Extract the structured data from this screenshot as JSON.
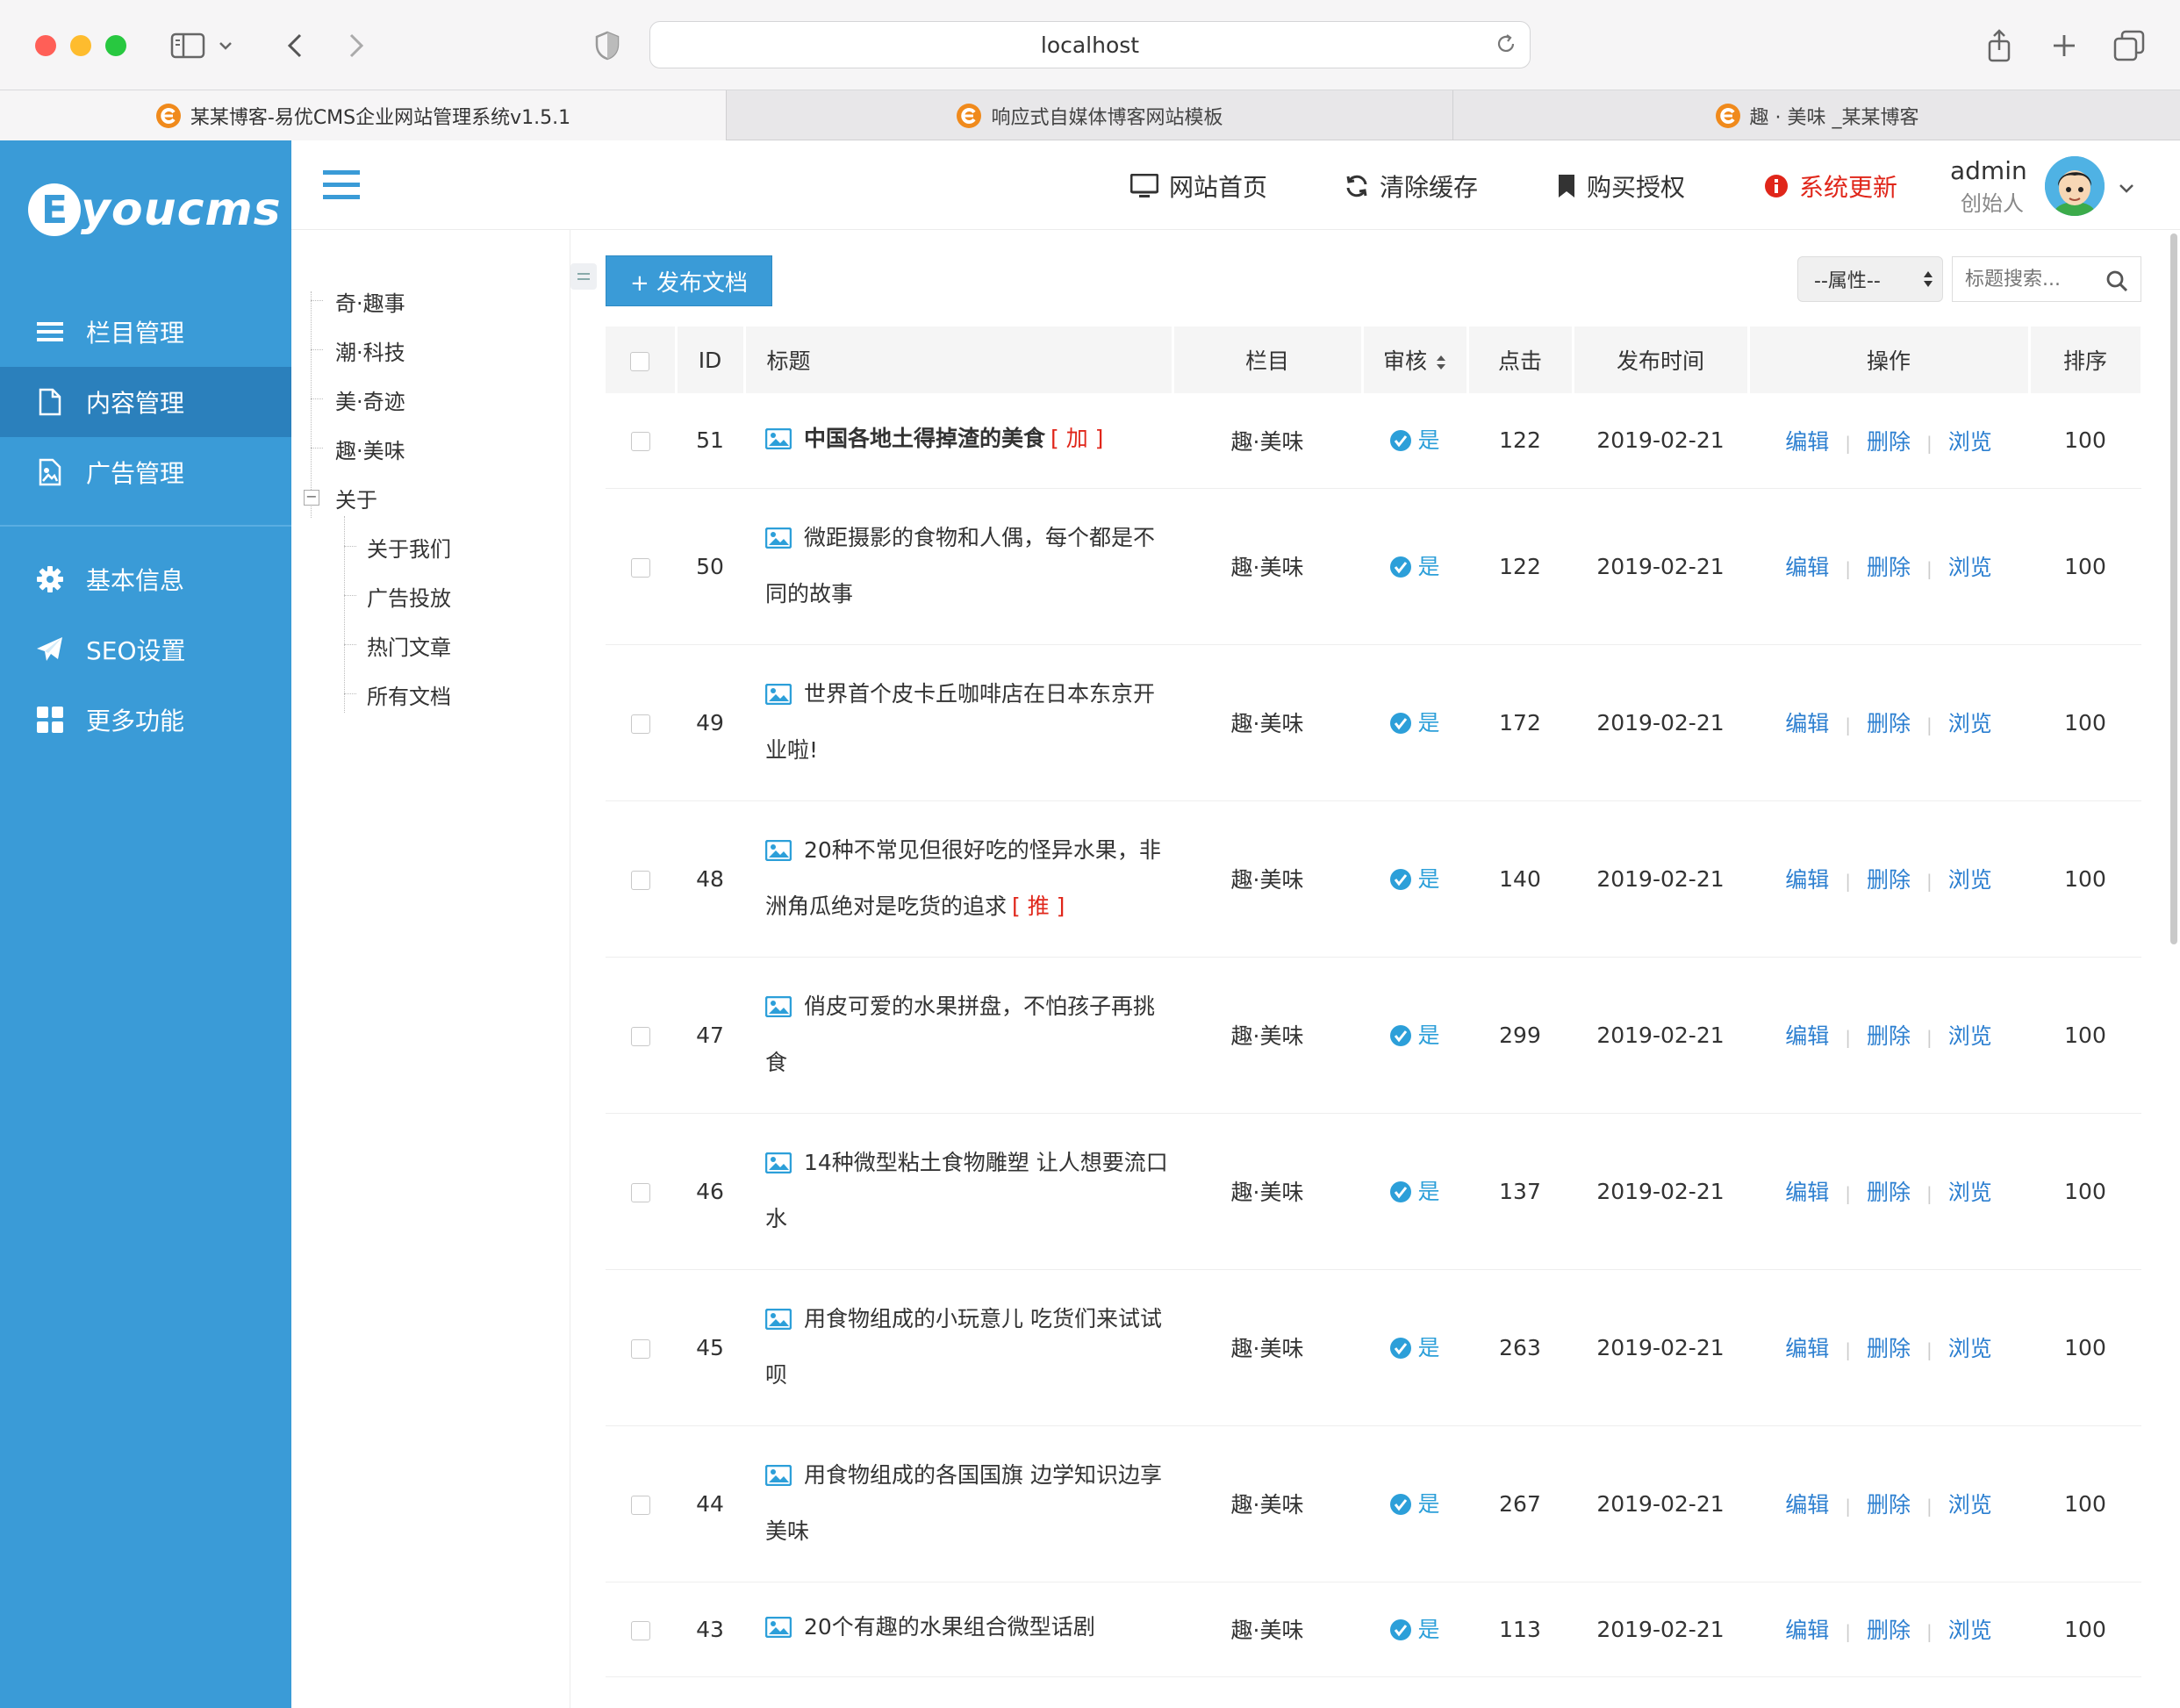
{
  "browser": {
    "address": "localhost",
    "tabs": [
      {
        "label": "某某博客-易优CMS企业网站管理系统v1.5.1",
        "active": true
      },
      {
        "label": "响应式自媒体博客网站模板",
        "active": false
      },
      {
        "label": "趣 · 美味 _某某博客",
        "active": false
      }
    ]
  },
  "sidebar": {
    "logo_text": "youcms",
    "logo_letter": "E",
    "items": [
      {
        "label": "栏目管理",
        "icon": "list-icon",
        "active": false
      },
      {
        "label": "内容管理",
        "icon": "document-icon",
        "active": true
      },
      {
        "label": "广告管理",
        "icon": "image-file-icon",
        "active": false
      },
      {
        "label": "基本信息",
        "icon": "gear-icon",
        "active": false
      },
      {
        "label": "SEO设置",
        "icon": "paper-plane-icon",
        "active": false
      },
      {
        "label": "更多功能",
        "icon": "grid-icon",
        "active": false
      }
    ]
  },
  "header": {
    "nav": [
      {
        "label": "网站首页",
        "icon": "monitor-icon"
      },
      {
        "label": "清除缓存",
        "icon": "refresh-icon"
      },
      {
        "label": "购买授权",
        "icon": "bookmark-icon"
      },
      {
        "label": "系统更新",
        "icon": "info-icon"
      }
    ],
    "admin_name": "admin",
    "admin_role": "创始人"
  },
  "tree": {
    "items": [
      "奇·趣事",
      "潮·科技",
      "美·奇迹",
      "趣·美味",
      "关于"
    ],
    "children": [
      "关于我们",
      "广告投放",
      "热门文章",
      "所有文档"
    ]
  },
  "toolbar": {
    "publish_label": "+ 发布文档",
    "attribute_select": "--属性--",
    "search_placeholder": "标题搜索..."
  },
  "table": {
    "columns": [
      "ID",
      "标题",
      "栏目",
      "审核",
      "点击",
      "发布时间",
      "操作",
      "排序"
    ],
    "actions": [
      "编辑",
      "删除",
      "浏览"
    ],
    "rows": [
      {
        "id": "51",
        "title": "中国各地土得掉渣的美食",
        "flag": "[ 加 ]",
        "bold": true,
        "column": "趣·美味",
        "audit": "是",
        "clicks": "122",
        "date": "2019-02-21",
        "sort": "100"
      },
      {
        "id": "50",
        "title": "微距摄影的食物和人偶，每个都是不同的故事",
        "flag": "",
        "bold": false,
        "column": "趣·美味",
        "audit": "是",
        "clicks": "122",
        "date": "2019-02-21",
        "sort": "100"
      },
      {
        "id": "49",
        "title": "世界首个皮卡丘咖啡店在日本东京开业啦!",
        "flag": "",
        "bold": false,
        "column": "趣·美味",
        "audit": "是",
        "clicks": "172",
        "date": "2019-02-21",
        "sort": "100"
      },
      {
        "id": "48",
        "title": "20种不常见但很好吃的怪异水果，非洲角瓜绝对是吃货的追求",
        "flag": "[ 推 ]",
        "bold": false,
        "column": "趣·美味",
        "audit": "是",
        "clicks": "140",
        "date": "2019-02-21",
        "sort": "100"
      },
      {
        "id": "47",
        "title": "俏皮可爱的水果拼盘，不怕孩子再挑食",
        "flag": "",
        "bold": false,
        "column": "趣·美味",
        "audit": "是",
        "clicks": "299",
        "date": "2019-02-21",
        "sort": "100"
      },
      {
        "id": "46",
        "title": "14种微型粘土食物雕塑 让人想要流口水",
        "flag": "",
        "bold": false,
        "column": "趣·美味",
        "audit": "是",
        "clicks": "137",
        "date": "2019-02-21",
        "sort": "100"
      },
      {
        "id": "45",
        "title": "用食物组成的小玩意儿 吃货们来试试呗",
        "flag": "",
        "bold": false,
        "column": "趣·美味",
        "audit": "是",
        "clicks": "263",
        "date": "2019-02-21",
        "sort": "100"
      },
      {
        "id": "44",
        "title": "用食物组成的各国国旗 边学知识边享美味",
        "flag": "",
        "bold": false,
        "column": "趣·美味",
        "audit": "是",
        "clicks": "267",
        "date": "2019-02-21",
        "sort": "100"
      },
      {
        "id": "43",
        "title": "20个有趣的水果组合微型话剧",
        "flag": "",
        "bold": false,
        "column": "趣·美味",
        "audit": "是",
        "clicks": "113",
        "date": "2019-02-21",
        "sort": "100"
      }
    ]
  },
  "colors": {
    "sidebar_bg": "#3a9bd7",
    "sidebar_active": "#2b80bc",
    "link": "#2c7fd0",
    "flag_red": "#e0261a",
    "audit_blue": "#2c9fd9"
  }
}
